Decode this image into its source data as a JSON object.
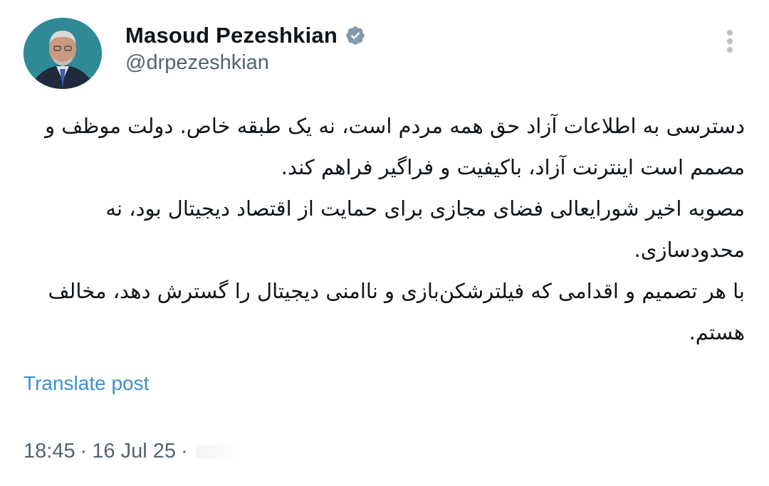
{
  "author": {
    "name": "Masoud Pezeshkian",
    "handle": "@drpezeshkian",
    "verified_icon": "verified-badge-icon",
    "verified_color": "#829aab"
  },
  "tweet": {
    "lines": [
      "دسترسی به اطلاعات آزاد حق همه مردم است، نه یک طبقه خاص. دولت موظف و مصمم است اینترنت آزاد، باکیفیت و فراگیر فراهم کند.",
      "مصوبه اخیر شورایعالی فضای مجازی برای حمایت از اقتصاد دیجیتال بود، نه محدودسازی.",
      "با هر تصمیم و اقدامی که فیلترشکن‌بازی و ناامنی دیجیتال را گسترش دهد، مخالف هستم."
    ]
  },
  "translate_label": "Translate post",
  "meta": {
    "time": "18:45",
    "separator": "·",
    "date": "16 Jul 25"
  },
  "colors": {
    "text": "#0f1419",
    "secondary": "#536471",
    "link": "#3d8fcc",
    "avatar_bg": "#2f8a95"
  }
}
